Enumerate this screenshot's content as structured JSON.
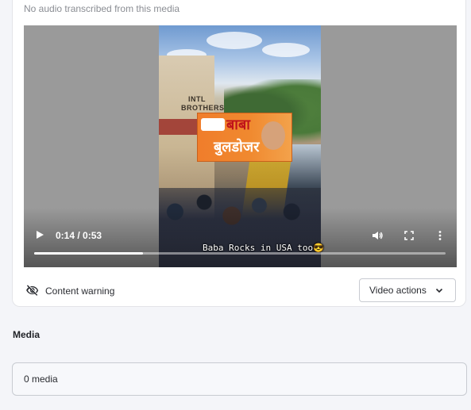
{
  "transcript": {
    "status_text": "No audio transcribed from this media"
  },
  "video": {
    "current_time": "0:14",
    "duration": "0:53",
    "time_display": "0:14 / 0:53",
    "progress_fraction": 0.264,
    "caption_text": "Baba Rocks in USA too😎",
    "banner_text_line1": "बाबा",
    "banner_text_line2": "बुलडोजर",
    "building_sign": "INTL\nBROTHERS",
    "icons": [
      "play-icon",
      "volume-icon",
      "fullscreen-icon",
      "more-vert-icon"
    ]
  },
  "content_warning": {
    "label": "Content warning",
    "icon": "eye-off-icon"
  },
  "video_actions": {
    "label": "Video actions",
    "icon": "chevron-down-icon"
  },
  "media": {
    "title": "Media",
    "count_text": "0 media"
  },
  "colors": {
    "page_bg": "#f4f5f9",
    "card_bg": "#ffffff",
    "border": "#c8cbd1",
    "text_primary": "#2a2c31",
    "text_muted": "#8a8d93"
  }
}
